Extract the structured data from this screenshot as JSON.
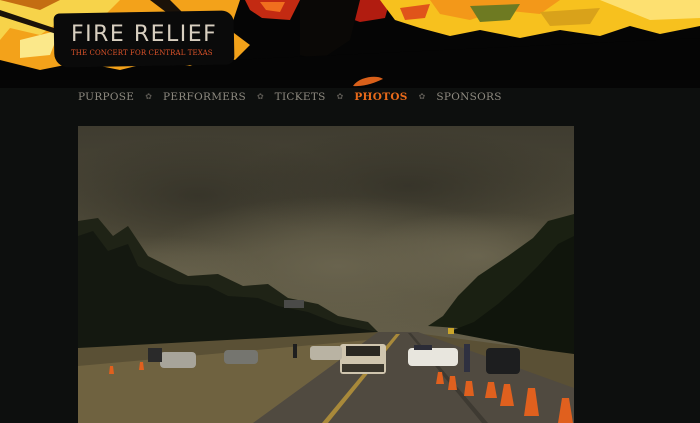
{
  "logo": {
    "title": "FIRE RELIEF",
    "subtitle": "THE CONCERT FOR CENTRAL TEXAS"
  },
  "nav": {
    "items": [
      {
        "label": "PURPOSE",
        "active": false
      },
      {
        "label": "PERFORMERS",
        "active": false
      },
      {
        "label": "TICKETS",
        "active": false
      },
      {
        "label": "PHOTOS",
        "active": true
      },
      {
        "label": "SPONSORS",
        "active": false
      }
    ],
    "separator_icon": "leaf-divider-icon"
  },
  "colors": {
    "background": "#0d0f0e",
    "accent": "#e96a1a",
    "nav_text": "#8e8a80",
    "logo_text": "#d8cfc0",
    "logo_subtitle": "#e0542a"
  },
  "photo": {
    "subject": "wildfire-smoke-over-highway-photo"
  }
}
